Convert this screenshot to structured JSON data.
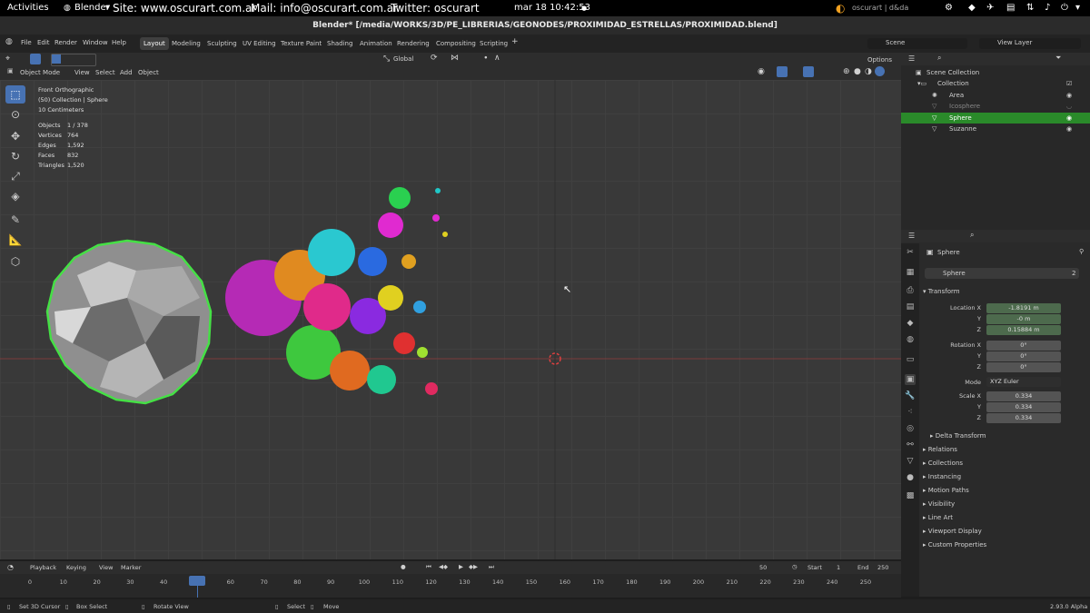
{
  "gnome": {
    "activities": "Activities",
    "app": "Blender",
    "site": "Site: www.oscurart.com.ar",
    "mail": "Mail: info@oscurart.com.ar",
    "twitter": "Twitter: oscurart",
    "datetime": "mar 18  10:42:53",
    "brand": "oscurart | d&da"
  },
  "window_title": "Blender* [/media/WORKS/3D/PE_LIBRERIAS/GEONODES/PROXIMIDAD_ESTRELLAS/PROXIMIDAD.blend]",
  "menu": [
    "File",
    "Edit",
    "Render",
    "Window",
    "Help"
  ],
  "workspaces": [
    "Layout",
    "Modeling",
    "Sculpting",
    "UV Editing",
    "Texture Paint",
    "Shading",
    "Animation",
    "Rendering",
    "Compositing",
    "Scripting"
  ],
  "active_workspace": "Layout",
  "scene": "Scene",
  "view_layer": "View Layer",
  "viewport_header": {
    "mode": "Object Mode",
    "items": [
      "View",
      "Select",
      "Add",
      "Object"
    ],
    "orientation": "Global",
    "options": "Options"
  },
  "viewport_info": {
    "view": "Front Orthographic",
    "collection": "(50) Collection | Sphere",
    "scale": "10 Centimeters",
    "stats": [
      {
        "k": "Objects",
        "v": "1 / 378"
      },
      {
        "k": "Vertices",
        "v": "764"
      },
      {
        "k": "Edges",
        "v": "1,592"
      },
      {
        "k": "Faces",
        "v": "832"
      },
      {
        "k": "Triangles",
        "v": "1,520"
      }
    ]
  },
  "outliner": {
    "root": "Scene Collection",
    "collection": "Collection",
    "items": [
      "Area",
      "Icosphere",
      "Sphere",
      "Suzanne"
    ],
    "selected": "Sphere"
  },
  "properties": {
    "object_name": "Sphere",
    "data_name": "Sphere",
    "users": "2",
    "transform_label": "Transform",
    "location": {
      "label_x": "Location X",
      "label_y": "Y",
      "label_z": "Z",
      "x": "-1.8191 m",
      "y": "-0 m",
      "z": "0.15884 m"
    },
    "rotation": {
      "label_x": "Rotation X",
      "label_y": "Y",
      "label_z": "Z",
      "x": "0°",
      "y": "0°",
      "z": "0°"
    },
    "mode_label": "Mode",
    "mode": "XYZ Euler",
    "scale": {
      "label_x": "Scale X",
      "label_y": "Y",
      "label_z": "Z",
      "x": "0.334",
      "y": "0.334",
      "z": "0.334"
    },
    "delta_transform": "Delta Transform",
    "panels": [
      "Relations",
      "Collections",
      "Instancing",
      "Motion Paths",
      "Visibility",
      "Line Art",
      "Viewport Display",
      "Custom Properties"
    ]
  },
  "timeline": {
    "menu": [
      "Playback",
      "Keying",
      "View",
      "Marker"
    ],
    "current_frame": "50",
    "start_label": "Start",
    "start": "1",
    "end_label": "End",
    "end": "250",
    "ticks": [
      "0",
      "10",
      "20",
      "30",
      "40",
      "50",
      "60",
      "70",
      "80",
      "90",
      "100",
      "110",
      "120",
      "130",
      "140",
      "150",
      "160",
      "170",
      "180",
      "190",
      "200",
      "210",
      "220",
      "230",
      "240",
      "250"
    ]
  },
  "statusbar": {
    "items": [
      "Set 3D Cursor",
      "Box Select",
      "Rotate View",
      "Select",
      "Move"
    ],
    "version": "2.93.0 Alpha"
  }
}
